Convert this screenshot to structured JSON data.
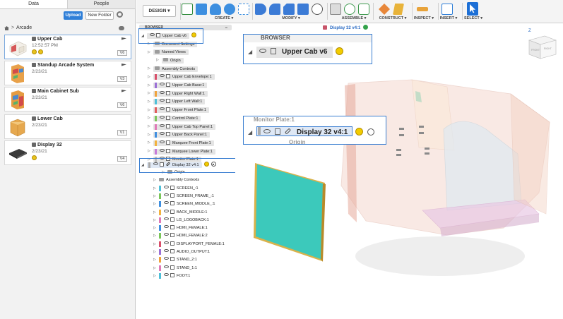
{
  "data_panel": {
    "tabs": [
      {
        "label": "Data",
        "active": true
      },
      {
        "label": "People",
        "active": false
      }
    ],
    "upload_label": "Upload",
    "new_folder_label": "New Folder",
    "breadcrumb": {
      "separator": ">",
      "project": "Arcade"
    },
    "files": [
      {
        "name": "Upper Cab",
        "date": "12:52:57 PM",
        "version": "V6",
        "selected": true
      },
      {
        "name": "Standup Arcade System",
        "date": "2/23/21",
        "version": "V3",
        "selected": false
      },
      {
        "name": "Main Cabinet Sub",
        "date": "2/23/21",
        "version": "V6",
        "selected": false
      },
      {
        "name": "Lower Cab",
        "date": "2/23/21",
        "version": "V1",
        "selected": false
      },
      {
        "name": "Display 32",
        "date": "2/23/21",
        "version": "V4",
        "selected": false
      }
    ]
  },
  "toolbar": {
    "workspace_label": "DESIGN ▾",
    "groups": [
      {
        "label": "CREATE ▾"
      },
      {
        "label": "MODIFY ▾"
      },
      {
        "label": "ASSEMBLE ▾"
      },
      {
        "label": "CONSTRUCT ▾"
      },
      {
        "label": "INSPECT ▾"
      },
      {
        "label": "INSERT ▾"
      },
      {
        "label": "SELECT ▾"
      }
    ],
    "colors": {
      "accent": "#1c6fd6",
      "create_blue": "#3d8fe0",
      "solid_blue": "#3b7bd6"
    }
  },
  "browser": {
    "header": "BROWSER",
    "root": "Upper Cab v6",
    "items": [
      {
        "label": "Document Settings",
        "type": "settings",
        "level": 1
      },
      {
        "label": "Named Views",
        "type": "folder",
        "level": 1
      },
      {
        "label": "Origin",
        "type": "folder",
        "level": 2
      },
      {
        "label": "Assembly Contexts",
        "type": "folder",
        "level": 1
      },
      {
        "label": "Upper Cab Envelope:1",
        "color": "#d94f6a"
      },
      {
        "label": "Upper Cab Base:1",
        "color": "#9b6fd6"
      },
      {
        "label": "Upper Right Wall:1",
        "color": "#f0a33c"
      },
      {
        "label": "Upper Left Wall:1",
        "color": "#4fc0d8"
      },
      {
        "label": "Upper Front Plate:1",
        "color": "#e15d5d"
      },
      {
        "label": "Control Plate:1",
        "color": "#7bc65a"
      },
      {
        "label": "Upper Cab Top Panel:1",
        "color": "#e07ab8"
      },
      {
        "label": "Upper Back Panel:1",
        "color": "#3f8fe0"
      },
      {
        "label": "Marquee Front Plate:1",
        "color": "#f2b23d"
      },
      {
        "label": "Marquee Lower Plate:1",
        "color": "#c77bd9"
      },
      {
        "label": "Monitor Plate:1",
        "color": "#bbbbbb"
      }
    ],
    "display": {
      "label": "Display 32 v4:1"
    },
    "sub_items": [
      {
        "label": "Origin",
        "type": "folder"
      },
      {
        "label": "Assembly Contexts",
        "type": "folder"
      },
      {
        "label": "SCREEN_:1",
        "color": "#4fc0d8"
      },
      {
        "label": "SCREEN_FRAME_:1",
        "color": "#7bc65a"
      },
      {
        "label": "SCREEN_MIDDLE_:1",
        "color": "#3f8fe0"
      },
      {
        "label": "BACK_MIDDLE:1",
        "color": "#f2b23d"
      },
      {
        "label": "LG_LOGOBACK:1",
        "color": "#e07ab8"
      },
      {
        "label": "HDMI_FEMALE:1",
        "color": "#3f8fe0"
      },
      {
        "label": "HDMI_FEMALE:2",
        "color": "#7bc65a"
      },
      {
        "label": "DISPLAYPORT_FEMALE:1",
        "color": "#d94f6a"
      },
      {
        "label": "AUDIO_OUTPUT:1",
        "color": "#9b6fd6"
      },
      {
        "label": "STAND_2:1",
        "color": "#f0a33c"
      },
      {
        "label": "STAND_1:1",
        "color": "#e07ab8"
      },
      {
        "label": "FOOT:1",
        "color": "#4fc0d8"
      }
    ]
  },
  "viewport": {
    "document_title": "Display 32 v4:1",
    "zoom_top": {
      "browser_label": "BROWSER",
      "root": "Upper Cab v6"
    },
    "zoom_mid": {
      "prev_label": "Monitor Plate:1",
      "display_label": "Display 32 v4:1",
      "next_label": "Origin"
    },
    "viewcube": {
      "axis": "Z",
      "face_front": "FRONT",
      "face_right": "RIGHT"
    },
    "screen_color": "#3cc9bb",
    "frame_color": "#d9b24a"
  }
}
